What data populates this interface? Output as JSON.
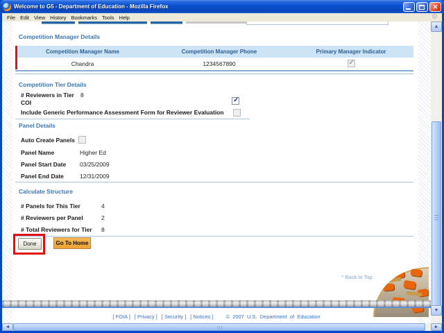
{
  "window": {
    "title": "Welcome to G5 - Department of Education - Mozilla Firefox",
    "menu": [
      "File",
      "Edit",
      "View",
      "History",
      "Bookmarks",
      "Tools",
      "Help"
    ]
  },
  "colors": {
    "section_heading_blue": "#3a77b4",
    "table_header_bg": "#cde3f6",
    "highlight_red": "#e01010",
    "home_button_orange": "#efa131",
    "footer_link_blue": "#3a6fc4"
  },
  "manager_details": {
    "heading": "Competition Manager Details",
    "columns": [
      "Competition Manager Name",
      "Competition Manager Phone",
      "Primary Manager Indicator"
    ],
    "row": {
      "name": "Chandra",
      "phone": "1234567890"
    }
  },
  "tier_details": {
    "heading": "Competition Tier Details",
    "reviewers_label": "# Reviewers in Tier",
    "reviewers_value": "8",
    "coi_label": "COI",
    "include_label": "Include Generic Performance Assessment Form for Reviewer Evaluation"
  },
  "panel_details": {
    "heading": "Panel Details",
    "auto_create_label": "Auto Create Panels",
    "name_label": "Panel Name",
    "name_value": "Higher Ed",
    "start_label": "Panel Start Date",
    "start_value": "03/25/2009",
    "end_label": "Panel End Date",
    "end_value": "12/31/2009"
  },
  "calculate_structure": {
    "heading": "Calculate Structure",
    "rows": [
      {
        "label": "# Panels for This Tier",
        "value": "4"
      },
      {
        "label": "# Reviewers per Panel",
        "value": "2"
      },
      {
        "label": "# Total Reviewers for Tier",
        "value": "8"
      }
    ]
  },
  "checkboxes": {
    "primary_manager": {
      "checked": true,
      "disabled": true
    },
    "coi": {
      "checked": true,
      "disabled": false
    },
    "include_generic": {
      "checked": false,
      "disabled": true
    },
    "auto_create_panels": {
      "checked": false,
      "disabled": true
    }
  },
  "actions": {
    "done": "Done",
    "go_to_home": "Go To Home"
  },
  "back_to_top": "^ Back to Top",
  "footer": {
    "links": [
      "[ FOIA ]",
      "[ Privacy ]",
      "[ Security ]",
      "[ Notices ]"
    ],
    "copyright": "© 2007 U.S. Department of Education"
  }
}
